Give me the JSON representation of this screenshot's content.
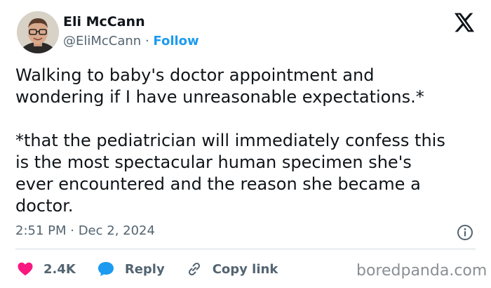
{
  "author": {
    "name": "Eli McCann",
    "handle": "@EliMcCann",
    "separator": " · ",
    "follow_label": "Follow"
  },
  "tweet": {
    "text": "Walking to baby's doctor appointment and\nwondering if I have unreasonable expectations.*\n\n*that the pediatrician will immediately confess this\nis the most spectacular human specimen she's\never encountered and the reason she became a\ndoctor.",
    "timestamp": "2:51 PM · Dec 2, 2024"
  },
  "actions": {
    "likes_count": "2.4K",
    "reply_label": "Reply",
    "copy_link_label": "Copy link"
  },
  "watermark": "boredpanda.com",
  "colors": {
    "accent": "#1d9bf0",
    "like": "#f91880",
    "reply": "#1d9bf0",
    "text": "#0f1419",
    "muted": "#536471"
  },
  "icons": {
    "brand": "x-logo-icon",
    "info": "info-icon",
    "like": "heart-icon",
    "reply": "speech-bubble-icon",
    "copy": "link-icon"
  }
}
